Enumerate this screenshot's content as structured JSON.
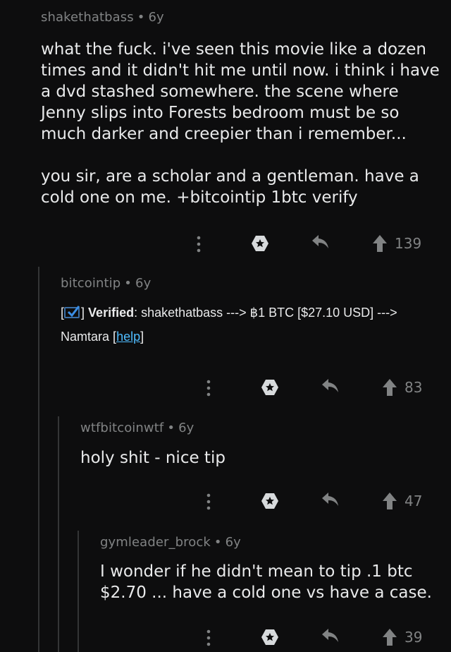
{
  "comments": [
    {
      "author": "shakethatbass",
      "age": "6y",
      "paragraphs": [
        "what the fuck. i've seen this movie like a dozen times and it didn't hit me until now. i think i have a dvd stashed somewhere. the scene where Jenny slips into Forests bedroom must be so much darker and creepier than i remember...",
        "you sir, are a scholar and a gentleman. have a cold one on me. +bitcointip 1btc verify"
      ],
      "score": "139"
    },
    {
      "author": "bitcointip",
      "age": "6y",
      "bracket_open": "[",
      "bracket_close": "]",
      "verified_label": "Verified",
      "verified_text": ": shakethatbass ---> ฿1 BTC [$27.10 USD] --->",
      "recipient": "Namtara",
      "help_open": "[",
      "help_label": "help",
      "help_close": "]",
      "score": "83"
    },
    {
      "author": "wtfbitcoinwtf",
      "age": "6y",
      "text": "holy shit - nice tip",
      "score": "47"
    },
    {
      "author": "gymleader_brock",
      "age": "6y",
      "text": "I wonder if he didn't mean to tip .1 btc $2.70 ... have a cold one vs have a case.",
      "score": "39"
    }
  ],
  "separator": "•",
  "icons": [
    "more-icon",
    "award-icon",
    "reply-icon",
    "upvote-icon",
    "check-icon"
  ],
  "colors": {
    "background": "#0d0d0e",
    "meta_text": "#818384",
    "body_text": "#e9eaeb",
    "link": "#4fbcff",
    "thread_line": "#343536"
  }
}
